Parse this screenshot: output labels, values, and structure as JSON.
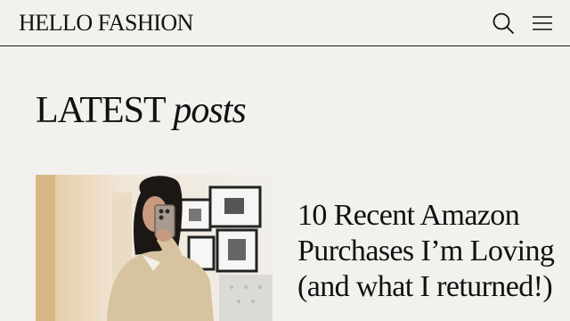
{
  "header": {
    "logo_text": "HELLO FASHION",
    "search_icon": "search-icon",
    "menu_icon": "hamburger-menu-icon"
  },
  "section": {
    "title_main": "LATEST",
    "title_italic": "posts"
  },
  "posts": [
    {
      "title": "10 Recent Amazon Purchases I’m Loving (and what I returned!)",
      "image_icon": "mirror-selfie-photo"
    }
  ],
  "colors": {
    "background": "#f3f1ee",
    "text": "#111111",
    "divider": "#1a1a1a"
  }
}
